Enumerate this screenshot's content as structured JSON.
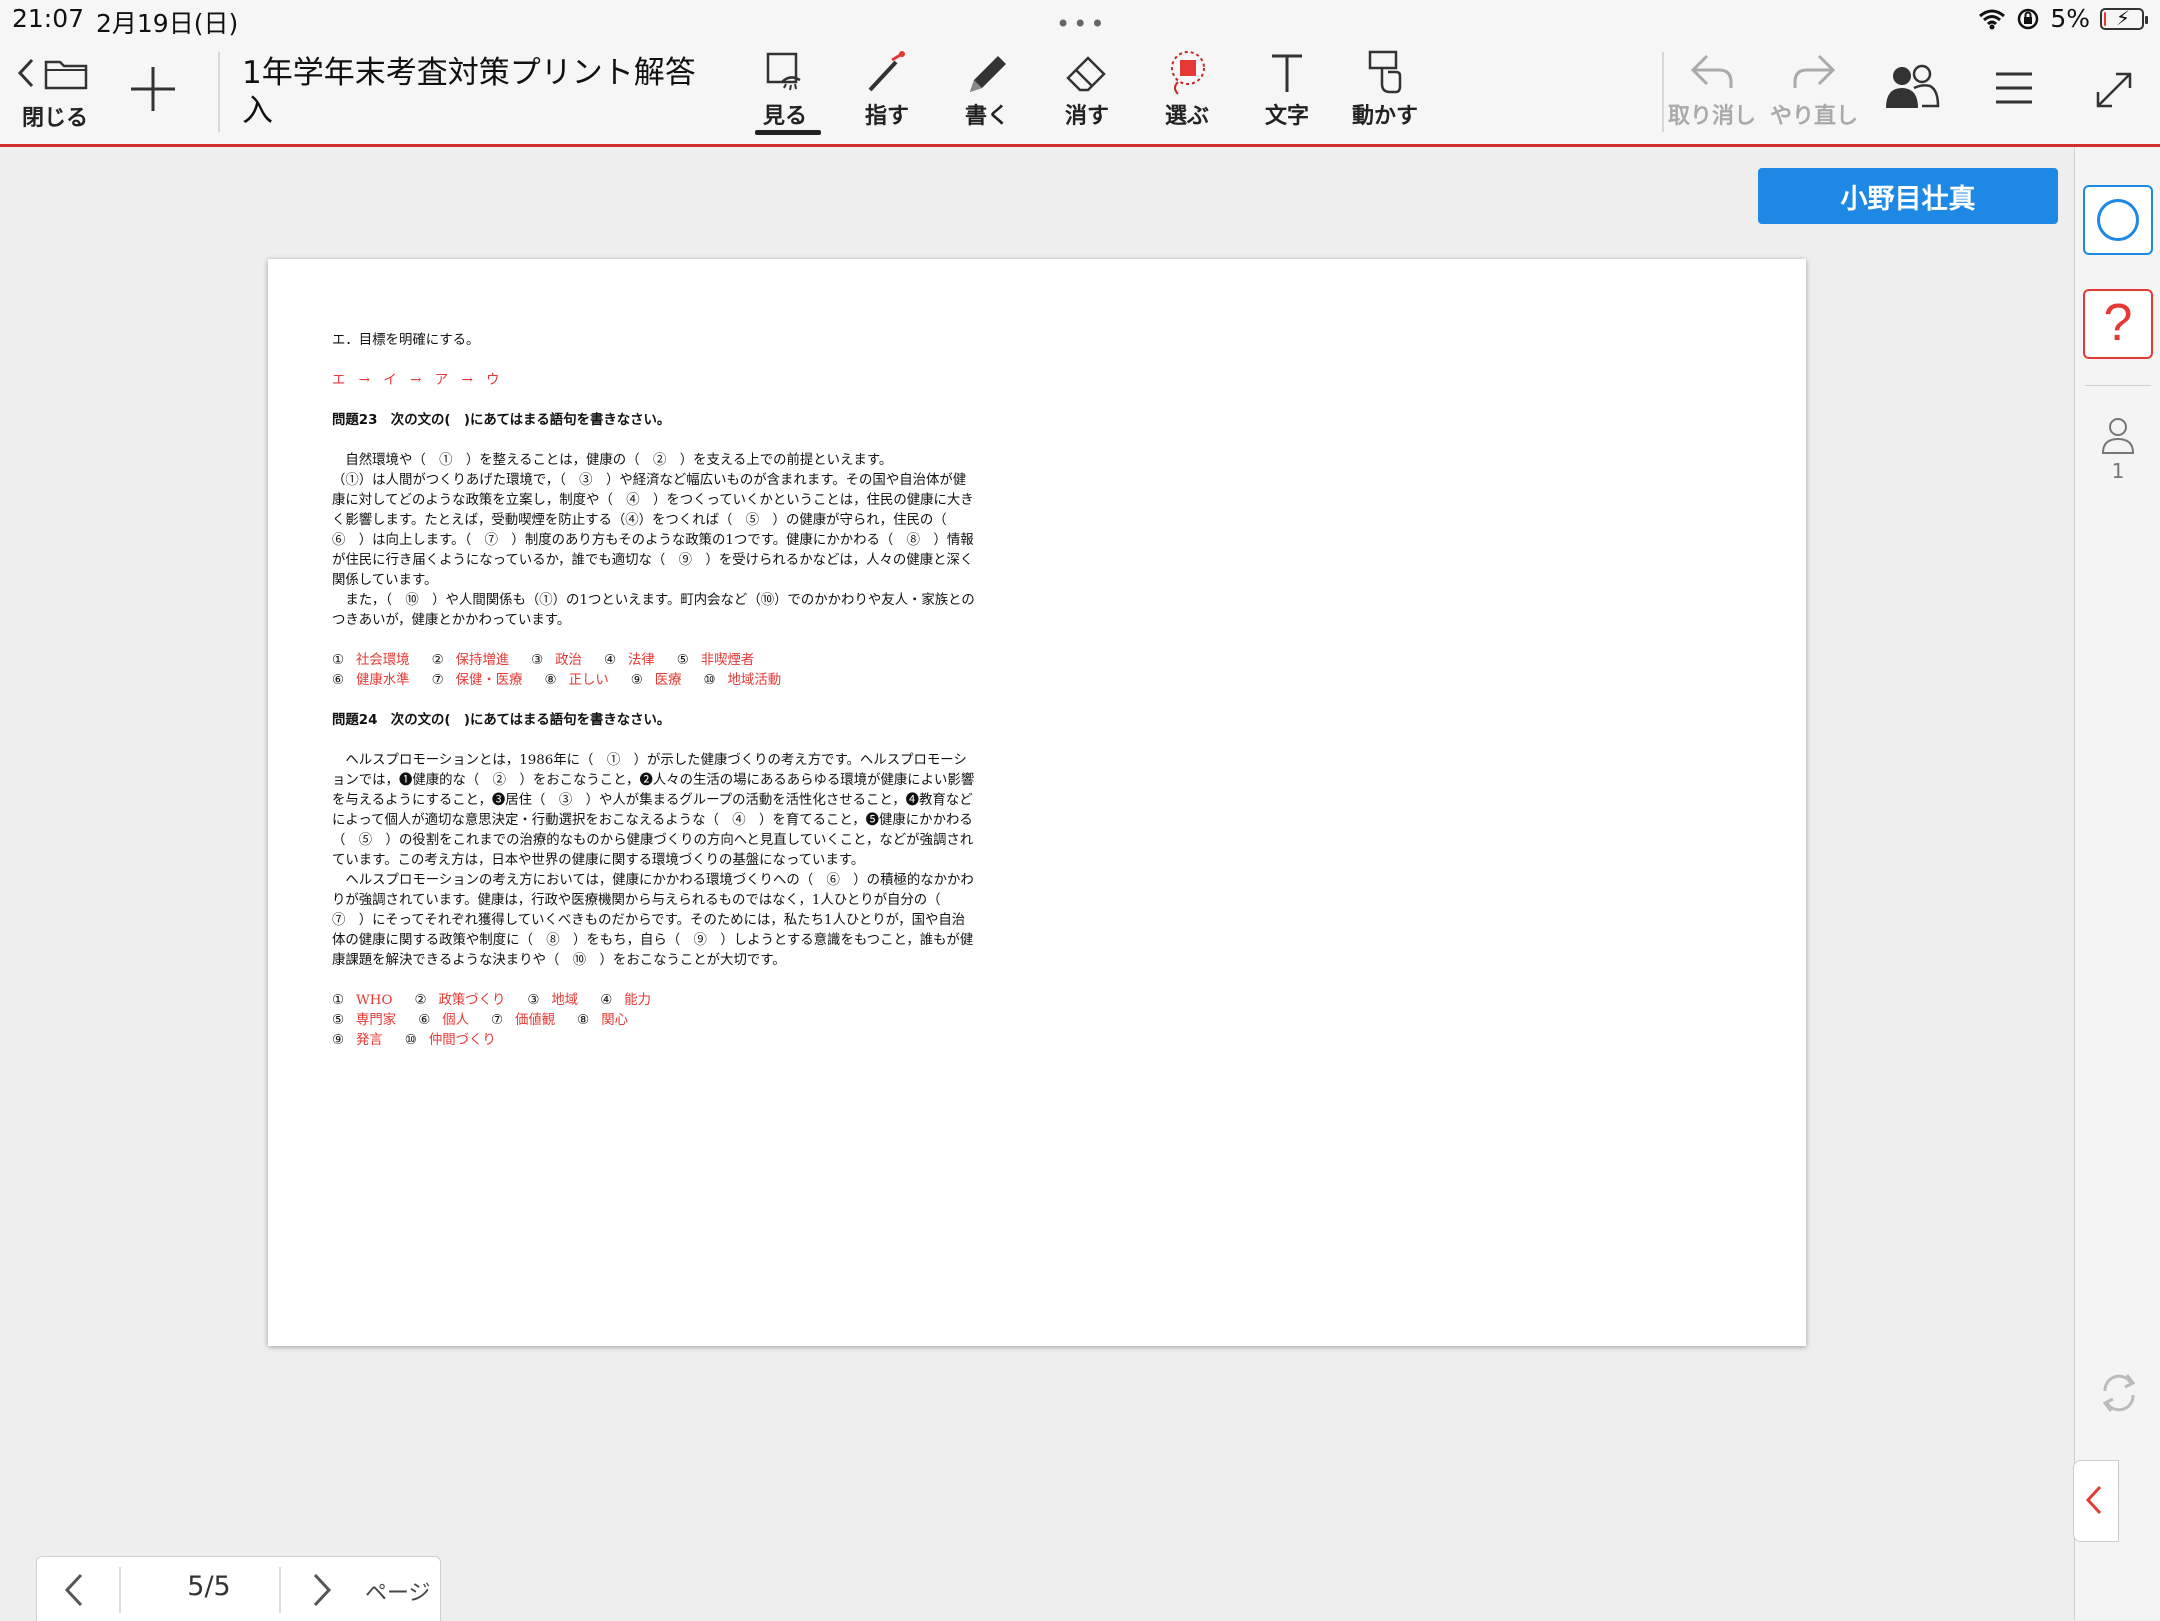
{
  "status_bar": {
    "time": "21:07",
    "date": "2月19日(日)",
    "battery": "5%",
    "battery_level": 0.05,
    "icons": [
      "wifi-icon",
      "orientation-lock-icon",
      "battery-charging-icon"
    ]
  },
  "toolbar": {
    "close_label": "閉じる",
    "document_title": "1年学年末考査対策プリント解答入",
    "tools": [
      {
        "label": "見る",
        "icon": "view-icon",
        "active": true
      },
      {
        "label": "指す",
        "icon": "laser-pointer-icon"
      },
      {
        "label": "書く",
        "icon": "pen-icon"
      },
      {
        "label": "消す",
        "icon": "eraser-icon"
      },
      {
        "label": "選ぶ",
        "icon": "lasso-select-icon"
      },
      {
        "label": "文字",
        "icon": "text-icon"
      },
      {
        "label": "動かす",
        "icon": "move-icon"
      }
    ],
    "undo_label": "取り消し",
    "redo_label": "やり直し"
  },
  "user_button": "小野目壮真",
  "sidebar": {
    "participant_count": "1"
  },
  "document": {
    "line_e": "エ．目標を明確にする。",
    "order_answer": "エ　→　イ　→　ア　→　ウ",
    "q23_heading": "問題23　次の文の(　)にあてはまる語句を書きなさい。",
    "q23_paragraph": [
      "　自然環境や（　①　）を整えることは，健康の（　②　）を支える上での前提といえます。",
      "（①）は人間がつくりあげた環境で，（　③　）や経済など幅広いものが含まれます。その国や自治体が健康に対してどのような政策を立案し，制度や（　④　）をつくっていくかということは，住民の健康に大きく影響します。たとえば，受動喫煙を防止する（④）をつくれば（　⑤　）の健康が守られ，住民の（　⑥　）は向上します。（　⑦　）制度のあり方もそのような政策の1つです。健康にかかわる（　⑧　）情報が住民に行き届くようになっているか，誰でも適切な（　⑨　）を受けられるかなどは，人々の健康と深く関係しています。",
      "　また，（　⑩　）や人間関係も（①）の1つといえます。町内会など（⑩）でのかかわりや友人・家族とのつきあいが，健康とかかわっています。"
    ],
    "q23_answers": [
      [
        {
          "n": "①",
          "t": "社会環境"
        },
        {
          "n": "②",
          "t": "保持増進"
        },
        {
          "n": "③",
          "t": "政治"
        },
        {
          "n": "④",
          "t": "法律"
        },
        {
          "n": "⑤",
          "t": "非喫煙者"
        }
      ],
      [
        {
          "n": "⑥",
          "t": "健康水準"
        },
        {
          "n": "⑦",
          "t": "保健・医療"
        },
        {
          "n": "⑧",
          "t": "正しい"
        },
        {
          "n": "⑨",
          "t": "医療"
        },
        {
          "n": "⑩",
          "t": "地域活動"
        }
      ]
    ],
    "q24_heading": "問題24　次の文の(　)にあてはまる語句を書きなさい。",
    "q24_paragraph": [
      "　ヘルスプロモーションとは，1986年に（　①　）が示した健康づくりの考え方です。ヘルスプロモーションでは，❶健康的な（　②　）をおこなうこと，❷人々の生活の場にあるあらゆる環境が健康によい影響を与えるようにすること，❸居住（　③　）や人が集まるグループの活動を活性化させること，❹教育などによって個人が適切な意思決定・行動選択をおこなえるような（　④　）を育てること，❺健康にかかわる（　⑤　）の役割をこれまでの治療的なものから健康づくりの方向へと見直していくこと，などが強調されています。この考え方は，日本や世界の健康に関する環境づくりの基盤になっています。",
      "　ヘルスプロモーションの考え方においては，健康にかかわる環境づくりへの（　⑥　）の積極的なかかわりが強調されています。健康は，行政や医療機関から与えられるものではなく，1人ひとりが自分の（　⑦　）にそってそれぞれ獲得していくべきものだからです。そのためには，私たち1人ひとりが，国や自治体の健康に関する政策や制度に（　⑧　）をもち，自ら（　⑨　）しようとする意識をもつこと，誰もが健康課題を解決できるような決まりや（　⑩　）をおこなうことが大切です。"
    ],
    "q24_answers": [
      [
        {
          "n": "①",
          "t": "WHO"
        },
        {
          "n": "②",
          "t": "政策づくり"
        },
        {
          "n": "③",
          "t": "地域"
        },
        {
          "n": "④",
          "t": "能力"
        }
      ],
      [
        {
          "n": "⑤",
          "t": "専門家"
        },
        {
          "n": "⑥",
          "t": "個人"
        },
        {
          "n": "⑦",
          "t": "価値観"
        },
        {
          "n": "⑧",
          "t": "関心"
        }
      ],
      [
        {
          "n": "⑨",
          "t": "発言"
        },
        {
          "n": "⑩",
          "t": "仲間づくり"
        }
      ]
    ]
  },
  "pager": {
    "page_indicator": "5/5",
    "label": "ページ"
  }
}
